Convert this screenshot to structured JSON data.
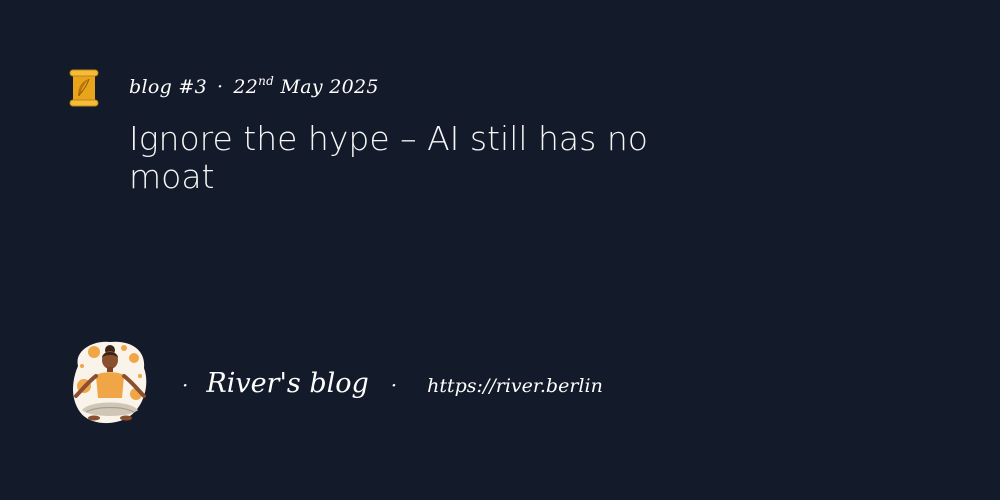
{
  "post": {
    "number": "blog #3",
    "separator": "·",
    "date_day": "22",
    "date_suffix": "nd",
    "date_rest": "May 2025",
    "title": "Ignore the hype – AI still has no moat"
  },
  "footer": {
    "lead_dot": "·",
    "blog_name": "River's blog",
    "mid_dot": "·",
    "url": "https://river.berlin"
  },
  "icons": {
    "post_icon": "scroll-quill-icon",
    "author_avatar": "meditating-person-avatar"
  },
  "colors": {
    "background": "#131a2a",
    "text": "#ffffff",
    "scroll_gold": "#e8a51c"
  }
}
